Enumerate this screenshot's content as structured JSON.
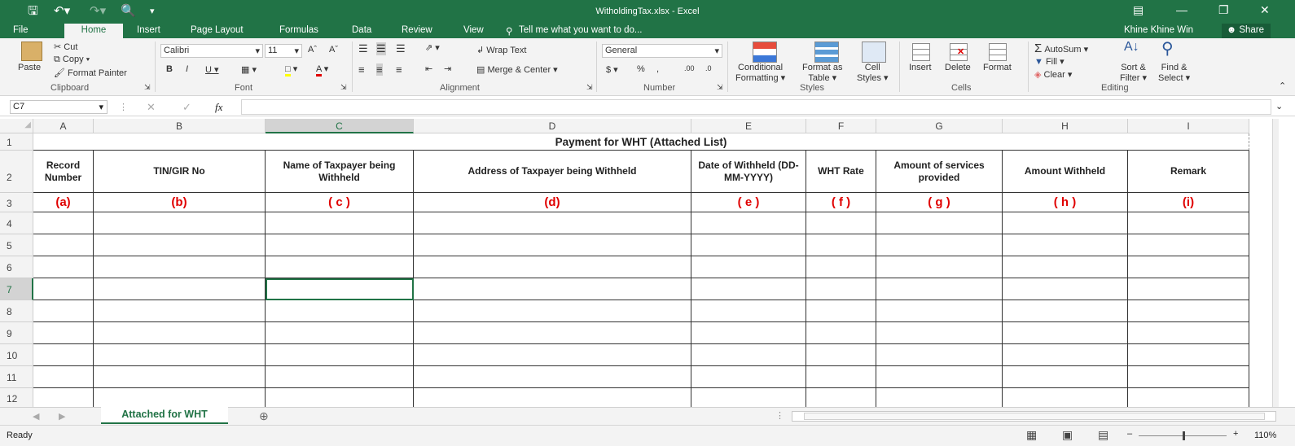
{
  "window": {
    "title": "WitholdingTax.xlsx - Excel",
    "user": "Khine Khine Win",
    "share": "Share"
  },
  "tabs": [
    "File",
    "Home",
    "Insert",
    "Page Layout",
    "Formulas",
    "Data",
    "Review",
    "View"
  ],
  "tell_me": "Tell me what you want to do...",
  "ribbon": {
    "clipboard": {
      "paste": "Paste",
      "cut": "Cut",
      "copy": "Copy",
      "format_painter": "Format Painter",
      "label": "Clipboard"
    },
    "font": {
      "name": "Calibri",
      "size": "11",
      "label": "Font"
    },
    "alignment": {
      "wrap": "Wrap Text",
      "merge": "Merge & Center",
      "label": "Alignment"
    },
    "number": {
      "format": "General",
      "label": "Number"
    },
    "styles": {
      "conditional": "Conditional",
      "conditional2": "Formatting",
      "format_as": "Format as",
      "format_as2": "Table",
      "cell": "Cell",
      "cell2": "Styles",
      "label": "Styles"
    },
    "cells": {
      "insert": "Insert",
      "delete": "Delete",
      "format": "Format",
      "label": "Cells"
    },
    "editing": {
      "autosum": "AutoSum",
      "fill": "Fill",
      "clear": "Clear",
      "sort": "Sort &",
      "sort2": "Filter",
      "find": "Find &",
      "find2": "Select",
      "label": "Editing"
    }
  },
  "formula_bar": {
    "name_box": "C7",
    "fx": "fx",
    "value": ""
  },
  "columns": [
    "A",
    "B",
    "C",
    "D",
    "E",
    "F",
    "G",
    "H",
    "I"
  ],
  "rows": [
    "1",
    "2",
    "3",
    "4",
    "5",
    "6",
    "7",
    "8",
    "9",
    "10",
    "11",
    "12"
  ],
  "sheet": {
    "title": "Payment for WHT (Attached List)",
    "headers": [
      "Record Number",
      "TIN/GIR No",
      "Name of Taxpayer being Withheld",
      "Address of Taxpayer being Withheld",
      "Date of Withheld (DD-MM-YYYY)",
      "WHT Rate",
      "Amount of services provided",
      "Amount Withheld",
      "Remark"
    ],
    "codes": [
      "(a)",
      "(b)",
      "( c )",
      "(d)",
      "( e )",
      "( f )",
      "( g )",
      "( h )",
      "(i)"
    ]
  },
  "sheet_tab": "Attached for WHT",
  "status": {
    "ready": "Ready",
    "zoom": "110%"
  }
}
